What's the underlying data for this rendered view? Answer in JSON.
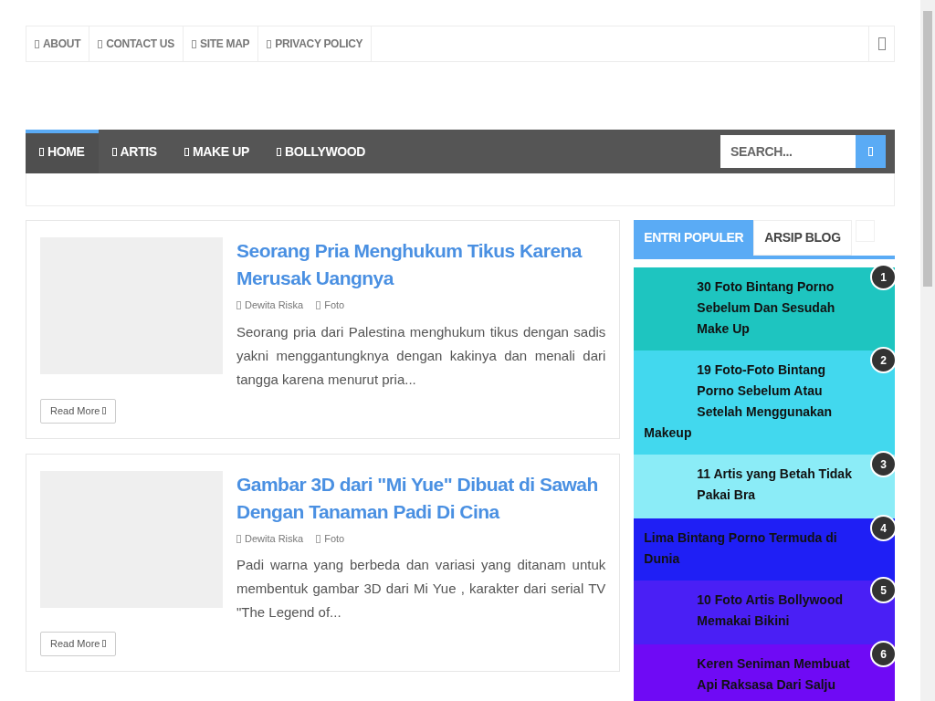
{
  "top_links": [
    "ABOUT",
    "CONTACT US",
    "SITE MAP",
    "PRIVACY POLICY"
  ],
  "nav": [
    {
      "label": "HOME",
      "selected": true
    },
    {
      "label": "ARTIS",
      "selected": false
    },
    {
      "label": "MAKE UP",
      "selected": false
    },
    {
      "label": "BOLLYWOOD",
      "selected": false
    }
  ],
  "search": {
    "placeholder": "SEARCH..."
  },
  "posts": [
    {
      "title": "Seorang Pria Menghukum Tikus Karena Merusak Uangnya",
      "author": "Dewita Riska",
      "category": "Foto",
      "excerpt": "Seorang pria dari Palestina menghukum tikus dengan sadis yakni menggantungknya dengan kakinya dan menali dari tangga karena menurut pria...",
      "button": "Read More"
    },
    {
      "title": "Gambar 3D dari \"Mi Yue\" Dibuat di Sawah Dengan Tanaman Padi Di Cina",
      "author": "Dewita Riska",
      "category": "Foto",
      "excerpt": "Padi warna yang berbeda dan variasi yang ditanam untuk membentuk gambar 3D dari Mi Yue , karakter dari serial TV \"The Legend of...",
      "button": "Read More"
    }
  ],
  "sidebar": {
    "tabs": [
      {
        "label": "ENTRI POPULER",
        "selected": true
      },
      {
        "label": "ARSIP BLOG",
        "selected": false
      }
    ],
    "popular": [
      {
        "rank": "1",
        "title": "30 Foto Bintang Porno Sebelum Dan Sesudah Make Up",
        "color": "#1ec5c0",
        "kind": "thumb"
      },
      {
        "rank": "2",
        "title": "19 Foto-Foto Bintang Porno Sebelum Atau Setelah Menggunakan Makeup",
        "color": "#42d8ee",
        "kind": "thumb"
      },
      {
        "rank": "3",
        "title": "11 Artis yang Betah Tidak Pakai Bra",
        "color": "#8becf7",
        "kind": "thumb"
      },
      {
        "rank": "4",
        "title": "Lima Bintang Porno Termuda di Dunia",
        "color": "#1f1ff5",
        "kind": "plain"
      },
      {
        "rank": "5",
        "title": "10 Foto Artis Bollywood Memakai Bikini",
        "color": "#4a1ff5",
        "kind": "thumb"
      },
      {
        "rank": "6",
        "title": "Keren Seniman Membuat Api Raksasa Dari Salju",
        "color": "#6f0af5",
        "kind": "thumb"
      }
    ]
  }
}
